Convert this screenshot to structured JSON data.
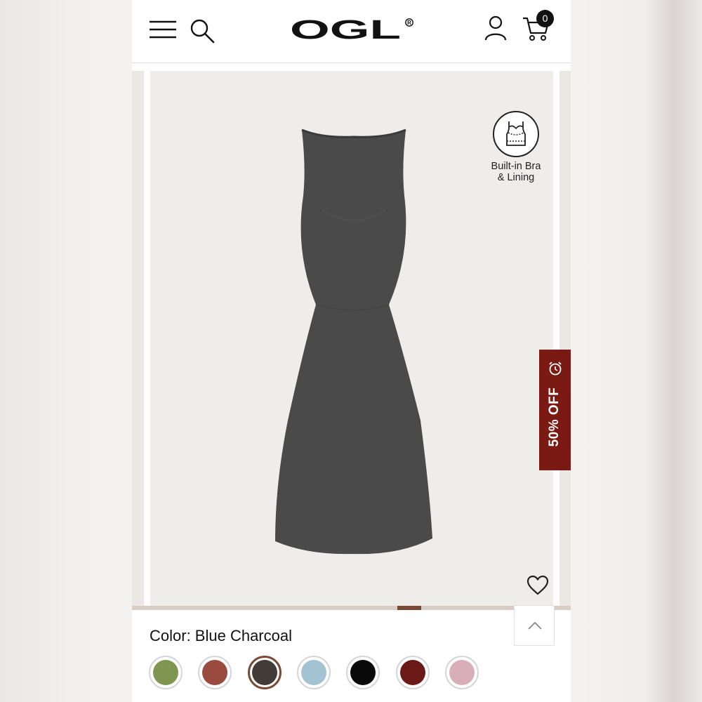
{
  "header": {
    "brand": "OGL",
    "cart_count": "0",
    "icons": [
      "menu-icon",
      "search-icon",
      "account-icon",
      "cart-icon"
    ]
  },
  "gallery": {
    "feature_badge": "Built-in Bra\n& Lining",
    "promo_tab": "50% OFF",
    "progress_fraction": 0.64,
    "dress_color": "#4a4a4a",
    "background_color": "#efedea"
  },
  "product": {
    "color_label": "Color: Blue Charcoal",
    "swatches": [
      {
        "name": "olive-green",
        "color": "#7e9650",
        "selected": false
      },
      {
        "name": "rust-red",
        "color": "#9a4a3e",
        "selected": false
      },
      {
        "name": "blue-charcoal",
        "color": "#433b38",
        "selected": true
      },
      {
        "name": "light-blue",
        "color": "#a3c3d3",
        "selected": false
      },
      {
        "name": "black",
        "color": "#0a0a0a",
        "selected": false
      },
      {
        "name": "burgundy",
        "color": "#6c1a18",
        "selected": false
      },
      {
        "name": "light-pink",
        "color": "#d9aebb",
        "selected": false
      }
    ]
  },
  "colors": {
    "accent": "#7a4a36",
    "promo": "#7b1a12"
  }
}
